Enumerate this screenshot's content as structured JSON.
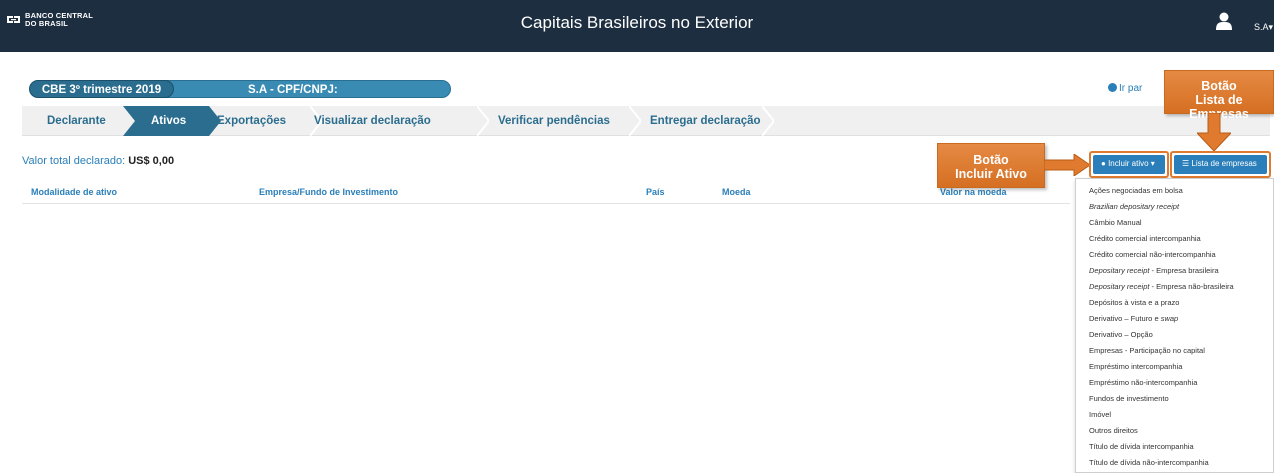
{
  "header": {
    "logo_line1": "BANCO CENTRAL",
    "logo_line2": "DO BRASIL",
    "title": "Capitais Brasileiros no Exterior",
    "user": "S.A",
    "user_icon": "user-icon"
  },
  "declaration": {
    "period": "CBE 3º trimestre 2019",
    "cnpj": "S.A - CPF/CNPJ:",
    "ir_link": "Ir par"
  },
  "steps": [
    {
      "label": "Declarante",
      "active": false
    },
    {
      "label": "Ativos",
      "active": true
    },
    {
      "label": "Exportações",
      "active": false
    },
    {
      "label": "Visualizar declaração",
      "active": false
    },
    {
      "label": "Verificar pendências",
      "active": false
    },
    {
      "label": "Entregar declaração",
      "active": false
    }
  ],
  "total": {
    "label": "Valor total declarado:",
    "value": "US$ 0,00"
  },
  "table": {
    "columns": [
      "Modalidade de ativo",
      "Empresa/Fundo de Investimento",
      "País",
      "Moeda",
      "Valor na moeda"
    ]
  },
  "buttons": {
    "incluir": "Incluir ativo",
    "lista": "Lista de empresas"
  },
  "callouts": {
    "ativo_line1": "Botão",
    "ativo_line2": "Incluir Ativo",
    "lista_line1": "Botão",
    "lista_line2": "Lista de Empresas"
  },
  "dropdown": {
    "items": [
      {
        "pre": "",
        "italic": "",
        "post": "Ações negociadas em bolsa"
      },
      {
        "pre": "",
        "italic": "Brazilian depositary receipt",
        "post": ""
      },
      {
        "pre": "",
        "italic": "",
        "post": "Câmbio Manual"
      },
      {
        "pre": "",
        "italic": "",
        "post": "Crédito comercial intercompanhia"
      },
      {
        "pre": "",
        "italic": "",
        "post": "Crédito comercial não-intercompanhia"
      },
      {
        "pre": "",
        "italic": "Depositary receipt",
        "post": "  - Empresa brasileira"
      },
      {
        "pre": "",
        "italic": "Depositary receipt",
        "post": "  - Empresa não-brasileira"
      },
      {
        "pre": "",
        "italic": "",
        "post": "Depósitos à vista e a prazo"
      },
      {
        "pre": "Derivativo – Futuro e ",
        "italic": "swap",
        "post": ""
      },
      {
        "pre": "",
        "italic": "",
        "post": "Derivativo – Opção"
      },
      {
        "pre": "",
        "italic": "",
        "post": "Empresas - Participação no capital"
      },
      {
        "pre": "",
        "italic": "",
        "post": "Empréstimo intercompanhia"
      },
      {
        "pre": "",
        "italic": "",
        "post": "Empréstimo não-intercompanhia"
      },
      {
        "pre": "",
        "italic": "",
        "post": "Fundos de investimento"
      },
      {
        "pre": "",
        "italic": "",
        "post": "Imóvel"
      },
      {
        "pre": "",
        "italic": "",
        "post": "Outros direitos"
      },
      {
        "pre": "",
        "italic": "",
        "post": "Título de dívida intercompanhia"
      },
      {
        "pre": "",
        "italic": "",
        "post": "Título de dívida não-intercompanhia"
      }
    ]
  }
}
